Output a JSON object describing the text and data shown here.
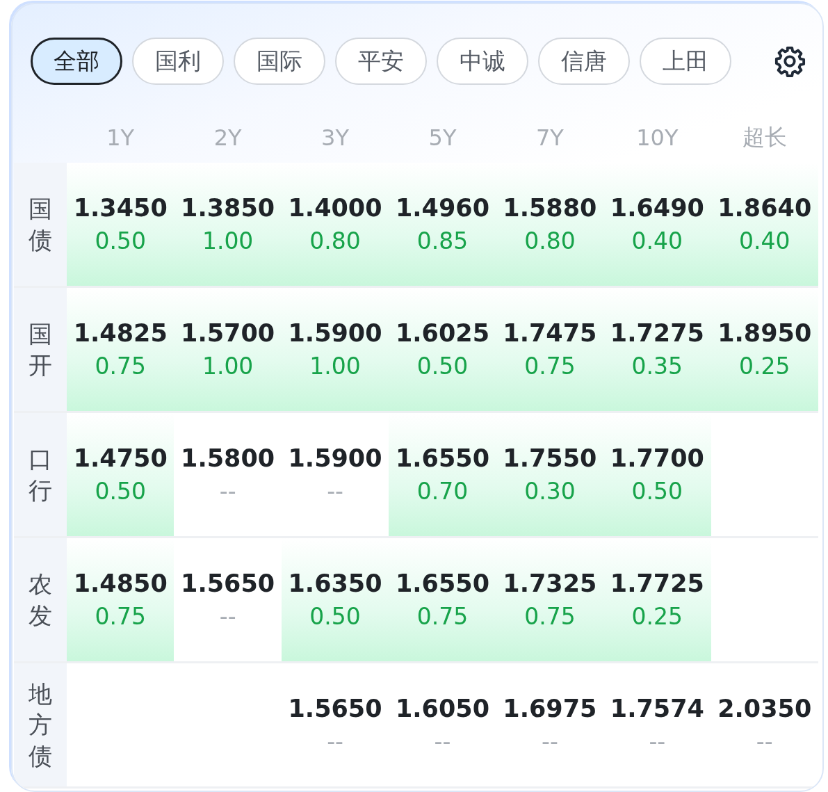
{
  "tabs": [
    {
      "label": "全部",
      "selected": true
    },
    {
      "label": "国利",
      "selected": false
    },
    {
      "label": "国际",
      "selected": false
    },
    {
      "label": "平安",
      "selected": false
    },
    {
      "label": "中诚",
      "selected": false
    },
    {
      "label": "信唐",
      "selected": false
    },
    {
      "label": "上田",
      "selected": false
    }
  ],
  "columns": [
    "1Y",
    "2Y",
    "3Y",
    "5Y",
    "7Y",
    "10Y",
    "超长"
  ],
  "rows": [
    {
      "label": "国债",
      "cells": [
        {
          "kind": "quote",
          "value": "1.3450",
          "change": "0.50",
          "highlighted": true
        },
        {
          "kind": "quote",
          "value": "1.3850",
          "change": "1.00",
          "highlighted": true
        },
        {
          "kind": "quote",
          "value": "1.4000",
          "change": "0.80",
          "highlighted": true
        },
        {
          "kind": "quote",
          "value": "1.4960",
          "change": "0.85",
          "highlighted": true
        },
        {
          "kind": "quote",
          "value": "1.5880",
          "change": "0.80",
          "highlighted": true
        },
        {
          "kind": "quote",
          "value": "1.6490",
          "change": "0.40",
          "highlighted": true
        },
        {
          "kind": "quote",
          "value": "1.8640",
          "change": "0.40",
          "highlighted": true
        }
      ]
    },
    {
      "label": "国开",
      "cells": [
        {
          "kind": "quote",
          "value": "1.4825",
          "change": "0.75",
          "highlighted": true
        },
        {
          "kind": "quote",
          "value": "1.5700",
          "change": "1.00",
          "highlighted": true
        },
        {
          "kind": "quote",
          "value": "1.5900",
          "change": "1.00",
          "highlighted": true
        },
        {
          "kind": "quote",
          "value": "1.6025",
          "change": "0.50",
          "highlighted": true
        },
        {
          "kind": "quote",
          "value": "1.7475",
          "change": "0.75",
          "highlighted": true
        },
        {
          "kind": "quote",
          "value": "1.7275",
          "change": "0.35",
          "highlighted": true
        },
        {
          "kind": "quote",
          "value": "1.8950",
          "change": "0.25",
          "highlighted": true
        }
      ]
    },
    {
      "label": "口行",
      "cells": [
        {
          "kind": "quote",
          "value": "1.4750",
          "change": "0.50",
          "highlighted": true
        },
        {
          "kind": "quote",
          "value": "1.5800",
          "change": "--",
          "highlighted": false
        },
        {
          "kind": "quote",
          "value": "1.5900",
          "change": "--",
          "highlighted": false
        },
        {
          "kind": "quote",
          "value": "1.6550",
          "change": "0.70",
          "highlighted": true
        },
        {
          "kind": "quote",
          "value": "1.7550",
          "change": "0.30",
          "highlighted": true
        },
        {
          "kind": "quote",
          "value": "1.7700",
          "change": "0.50",
          "highlighted": true
        },
        {
          "kind": "empty"
        }
      ]
    },
    {
      "label": "农发",
      "cells": [
        {
          "kind": "quote",
          "value": "1.4850",
          "change": "0.75",
          "highlighted": true
        },
        {
          "kind": "quote",
          "value": "1.5650",
          "change": "--",
          "highlighted": false
        },
        {
          "kind": "quote",
          "value": "1.6350",
          "change": "0.50",
          "highlighted": true
        },
        {
          "kind": "quote",
          "value": "1.6550",
          "change": "0.75",
          "highlighted": true
        },
        {
          "kind": "quote",
          "value": "1.7325",
          "change": "0.75",
          "highlighted": true
        },
        {
          "kind": "quote",
          "value": "1.7725",
          "change": "0.25",
          "highlighted": true
        },
        {
          "kind": "empty"
        }
      ]
    },
    {
      "label": "地方债",
      "cells": [
        {
          "kind": "empty"
        },
        {
          "kind": "empty"
        },
        {
          "kind": "quote",
          "value": "1.5650",
          "change": "--",
          "highlighted": false
        },
        {
          "kind": "quote",
          "value": "1.6050",
          "change": "--",
          "highlighted": false
        },
        {
          "kind": "quote",
          "value": "1.6975",
          "change": "--",
          "highlighted": false
        },
        {
          "kind": "quote",
          "value": "1.7574",
          "change": "--",
          "highlighted": false
        },
        {
          "kind": "quote",
          "value": "2.0350",
          "change": "--",
          "highlighted": false
        }
      ]
    }
  ]
}
